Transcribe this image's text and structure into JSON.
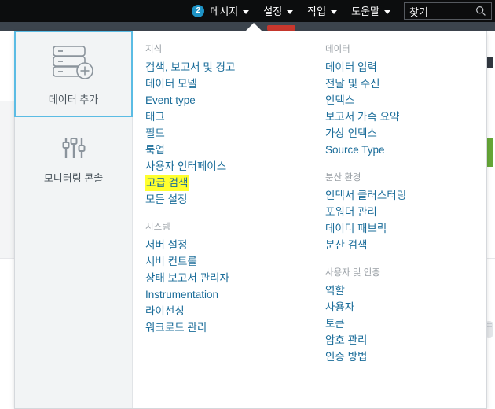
{
  "topnav": {
    "items": [
      {
        "label": "메시지",
        "badge": "2",
        "has_caret": true,
        "name": "messages"
      },
      {
        "label": "설정",
        "badge": null,
        "has_caret": true,
        "name": "settings"
      },
      {
        "label": "작업",
        "badge": null,
        "has_caret": true,
        "name": "activity"
      },
      {
        "label": "도움말",
        "badge": null,
        "has_caret": true,
        "name": "help"
      }
    ],
    "search": {
      "value": "찾기",
      "placeholder": "찾기",
      "icon": "search-icon"
    },
    "badge_color": "#1e93c6"
  },
  "dropdown": {
    "cards": [
      {
        "label": "데이터 추가",
        "icon": "server-add-icon",
        "selected": true
      },
      {
        "label": "모니터링 콘솔",
        "icon": "sliders-icon",
        "selected": false
      }
    ],
    "columns": [
      {
        "groups": [
          {
            "title": "지식",
            "links": [
              {
                "label": "검색, 보고서 및 경고",
                "highlight": false
              },
              {
                "label": "데이터 모델",
                "highlight": false
              },
              {
                "label": "Event type",
                "highlight": false
              },
              {
                "label": "태그",
                "highlight": false
              },
              {
                "label": "필드",
                "highlight": false
              },
              {
                "label": "룩업",
                "highlight": false
              },
              {
                "label": "사용자 인터페이스",
                "highlight": false
              },
              {
                "label": "고급 검색",
                "highlight": true
              },
              {
                "label": "모든 설정",
                "highlight": false
              }
            ]
          },
          {
            "title": "시스템",
            "links": [
              {
                "label": "서버 설정",
                "highlight": false
              },
              {
                "label": "서버 컨트롤",
                "highlight": false
              },
              {
                "label": "상태 보고서 관리자",
                "highlight": false
              },
              {
                "label": "Instrumentation",
                "highlight": false
              },
              {
                "label": "라이선싱",
                "highlight": false
              },
              {
                "label": "워크로드 관리",
                "highlight": false
              }
            ]
          }
        ]
      },
      {
        "groups": [
          {
            "title": "데이터",
            "links": [
              {
                "label": "데이터 입력",
                "highlight": false
              },
              {
                "label": "전달 및 수신",
                "highlight": false
              },
              {
                "label": "인덱스",
                "highlight": false
              },
              {
                "label": "보고서 가속 요약",
                "highlight": false
              },
              {
                "label": "가상 인덱스",
                "highlight": false
              },
              {
                "label": "Source Type",
                "highlight": false
              }
            ]
          },
          {
            "title": "분산 환경",
            "links": [
              {
                "label": "인덱서 클러스터링",
                "highlight": false
              },
              {
                "label": "포워더 관리",
                "highlight": false
              },
              {
                "label": "데이터 패브릭",
                "highlight": false
              },
              {
                "label": "분산 검색",
                "highlight": false
              }
            ]
          },
          {
            "title": "사용자 및 인증",
            "links": [
              {
                "label": "역할",
                "highlight": false
              },
              {
                "label": "사용자",
                "highlight": false
              },
              {
                "label": "토큰",
                "highlight": false
              },
              {
                "label": "암호 관리",
                "highlight": false
              },
              {
                "label": "인증 방법",
                "highlight": false
              }
            ]
          }
        ]
      }
    ]
  },
  "colors": {
    "topbar_bg": "#0c0d0e",
    "strip_bg": "#3c444d",
    "link": "#1a6c99",
    "group_title": "#9aa0a6",
    "card_bg": "#f2f4f5",
    "card_selected_border": "#5bbce4",
    "highlight": "#ffff2e",
    "accent_green": "#65a637",
    "accent_red": "#c8372d"
  }
}
